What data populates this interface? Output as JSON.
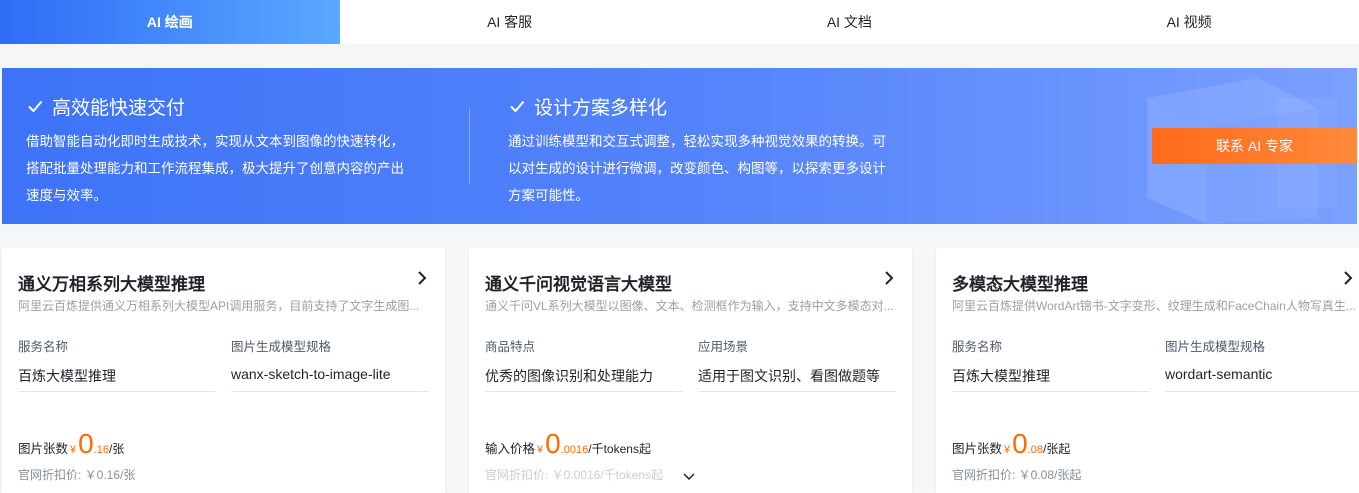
{
  "tabs": [
    {
      "label": "AI 绘画",
      "active": true
    },
    {
      "label": "AI 客服",
      "active": false
    },
    {
      "label": "AI 文档",
      "active": false
    },
    {
      "label": "AI 视频",
      "active": false
    }
  ],
  "banner": {
    "features": [
      {
        "title": "高效能快速交付",
        "desc": [
          "借助智能自动化即时生成技术，实现从文本到图像的快速转化，",
          "搭配批量处理能力和工作流程集成，极大提升了创意内容的产出",
          "速度与效率。"
        ]
      },
      {
        "title": "设计方案多样化",
        "desc": [
          "通过训练模型和交互式调整，轻松实现多种视觉效果的转换。可",
          "以对生成的设计进行微调，改变颜色、构图等，以探索更多设计",
          "方案可能性。"
        ]
      }
    ],
    "cta_label": "联系 AI 专家"
  },
  "cards": [
    {
      "title": "通义万相系列大模型推理",
      "desc": "阿里云百炼提供通义万相系列大模型API调用服务，目前支持了文字生成图...",
      "col_a": {
        "label": "服务名称",
        "value": "百炼大模型推理"
      },
      "col_b": {
        "label": "图片生成模型规格",
        "value": "wanx-sketch-to-image-lite"
      },
      "price": {
        "label": "图片张数",
        "yen": "¥",
        "int": "0",
        "dec": ".16",
        "unit": "/张"
      },
      "original": "官网折扣价: ￥0.16/张"
    },
    {
      "title": "通义千问视觉语言大模型",
      "desc": "通义千问VL系列大模型以图像、文本、检测框作为输入，支持中文多模态对...",
      "col_a": {
        "label": "商品特点",
        "value": "优秀的图像识别和处理能力"
      },
      "col_b": {
        "label": "应用场景",
        "value": "适用于图文识别、看图做题等"
      },
      "price": {
        "label": "输入价格",
        "yen": "¥",
        "int": "0",
        "dec": ".0016",
        "unit": "/千tokens起"
      },
      "original": "官网折扣价: ￥0.0016/千tokens起"
    },
    {
      "title": "多模态大模型推理",
      "desc": "阿里云百炼提供WordArt锦书-文字变形、纹理生成和FaceChain人物写真生...",
      "col_a": {
        "label": "服务名称",
        "value": "百炼大模型推理"
      },
      "col_b": {
        "label": "图片生成模型规格",
        "value": "wordart-semantic"
      },
      "price": {
        "label": "图片张数",
        "yen": "¥",
        "int": "0",
        "dec": ".08",
        "unit": "/张起"
      },
      "original": "官网折扣价: ￥0.08/张起"
    }
  ],
  "icons": {
    "check": "check-icon",
    "arrow": "chevron-right-icon",
    "expand": "chevron-down-icon"
  },
  "colors": {
    "accent": "#3d73f7",
    "price": "#ff6a00",
    "cta": "#ff6a1a"
  }
}
